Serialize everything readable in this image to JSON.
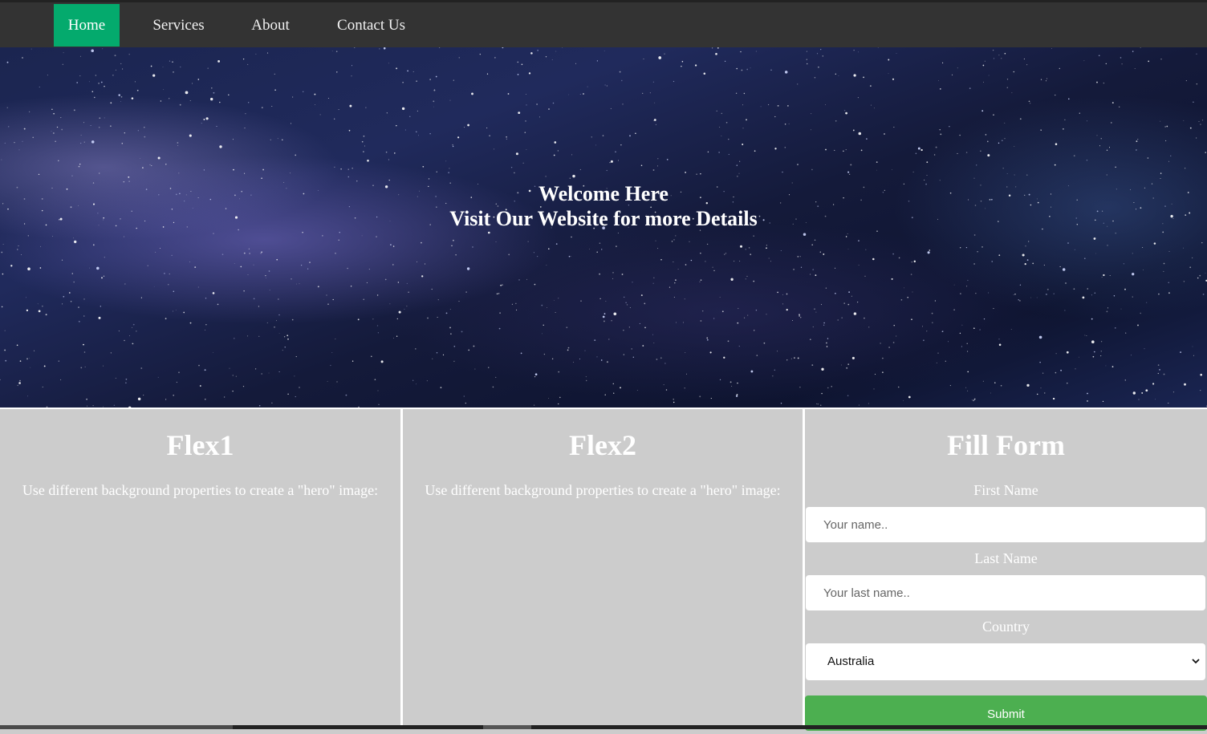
{
  "nav": {
    "items": [
      {
        "label": "Home",
        "active": true
      },
      {
        "label": "Services",
        "active": false
      },
      {
        "label": "About",
        "active": false
      },
      {
        "label": "Contact Us",
        "active": false
      }
    ],
    "active_color": "#04AA6D",
    "background": "#333333"
  },
  "hero": {
    "line1": "Welcome Here",
    "line2": "Visit Our Website for more Details"
  },
  "columns": [
    {
      "title": "Flex1",
      "text": "Use different background properties to create a \"hero\" image:"
    },
    {
      "title": "Flex2",
      "text": "Use different background properties to create a \"hero\" image:"
    }
  ],
  "form": {
    "title": "Fill Form",
    "first_name_label": "First Name",
    "first_name_placeholder": "Your name..",
    "last_name_label": "Last Name",
    "last_name_placeholder": "Your last name..",
    "country_label": "Country",
    "country_value": "Australia",
    "submit_label": "Submit",
    "submit_color": "#4CAF50"
  },
  "icons": {
    "select_arrow": "chevron-down-icon"
  }
}
